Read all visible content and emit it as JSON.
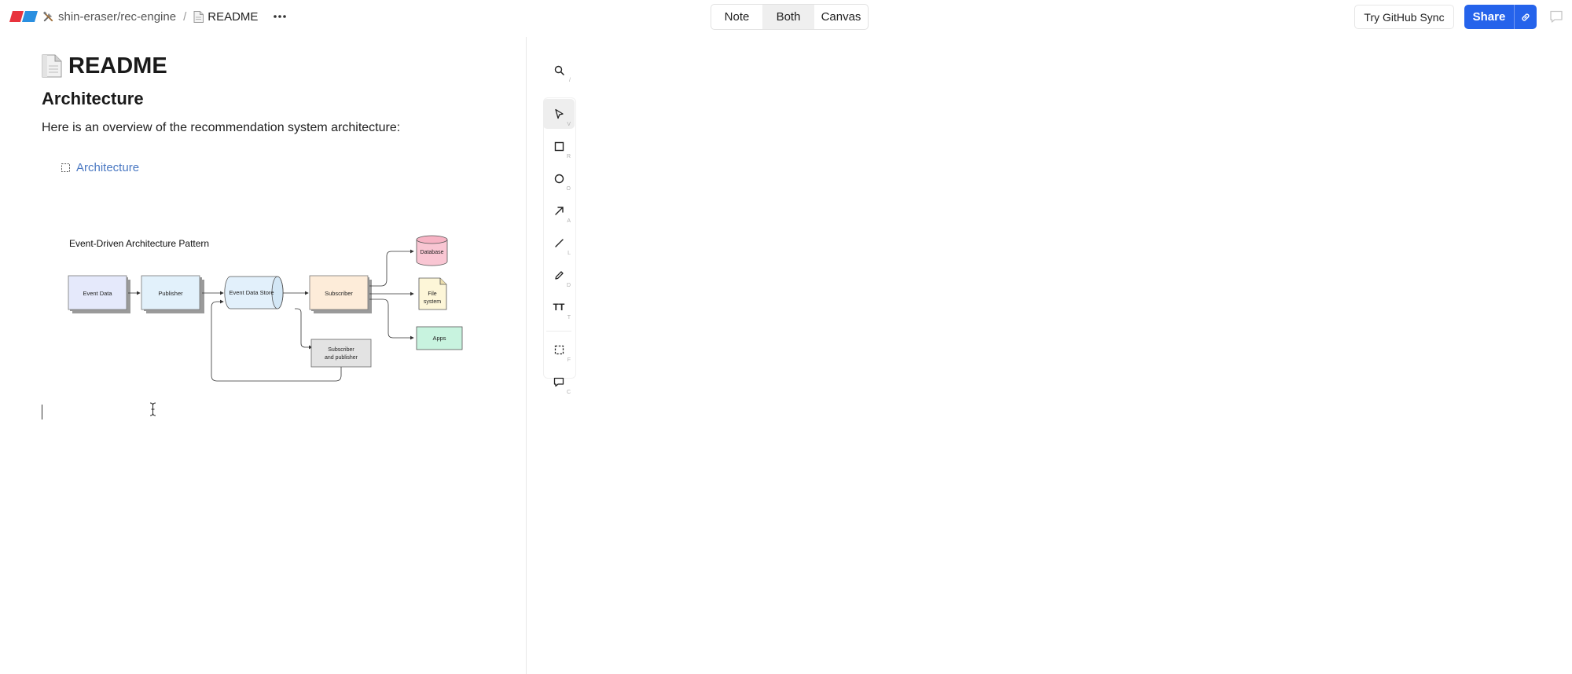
{
  "breadcrumb": {
    "workspace": "shin-eraser/rec-engine",
    "separator": "/",
    "file": "README"
  },
  "view_toggle": {
    "note": "Note",
    "both": "Both",
    "canvas": "Canvas",
    "selected": "Both"
  },
  "header": {
    "github_sync": "Try GitHub Sync",
    "share": "Share"
  },
  "document": {
    "title": "README",
    "heading": "Architecture",
    "paragraph": "Here is an overview of the recommendation system architecture:",
    "embed_link": "Architecture"
  },
  "diagram": {
    "title": "Event-Driven Architecture Pattern",
    "nodes": {
      "event_data": "Event Data",
      "publisher": "Publisher",
      "event_data_store": "Event Data Store",
      "subscriber": "Subscriber",
      "database": "Database",
      "file_system_1": "File",
      "file_system_2": "system",
      "apps": "Apps",
      "subpub_1": "Subscriber",
      "subpub_2": "and publisher"
    },
    "colors": {
      "event_data": "#e5e9fb",
      "publisher": "#e2f1fb",
      "event_data_store": "#e2f0fb",
      "subscriber": "#fdecd9",
      "database": "#f9c6d3",
      "file_system": "#fdf6d8",
      "apps": "#c8f3df",
      "subpub": "#e3e3e3"
    }
  },
  "toolbar": {
    "tools": [
      {
        "key": "/"
      },
      {
        "key": "V"
      },
      {
        "key": "R"
      },
      {
        "key": "O"
      },
      {
        "key": "A"
      },
      {
        "key": "L"
      },
      {
        "key": "D"
      },
      {
        "key": "T"
      },
      {
        "key": "F"
      },
      {
        "key": "C"
      }
    ],
    "text_tool_glyph": "TT",
    "active": "select"
  },
  "colors": {
    "accent": "#2563eb",
    "link": "#4a78c2"
  }
}
